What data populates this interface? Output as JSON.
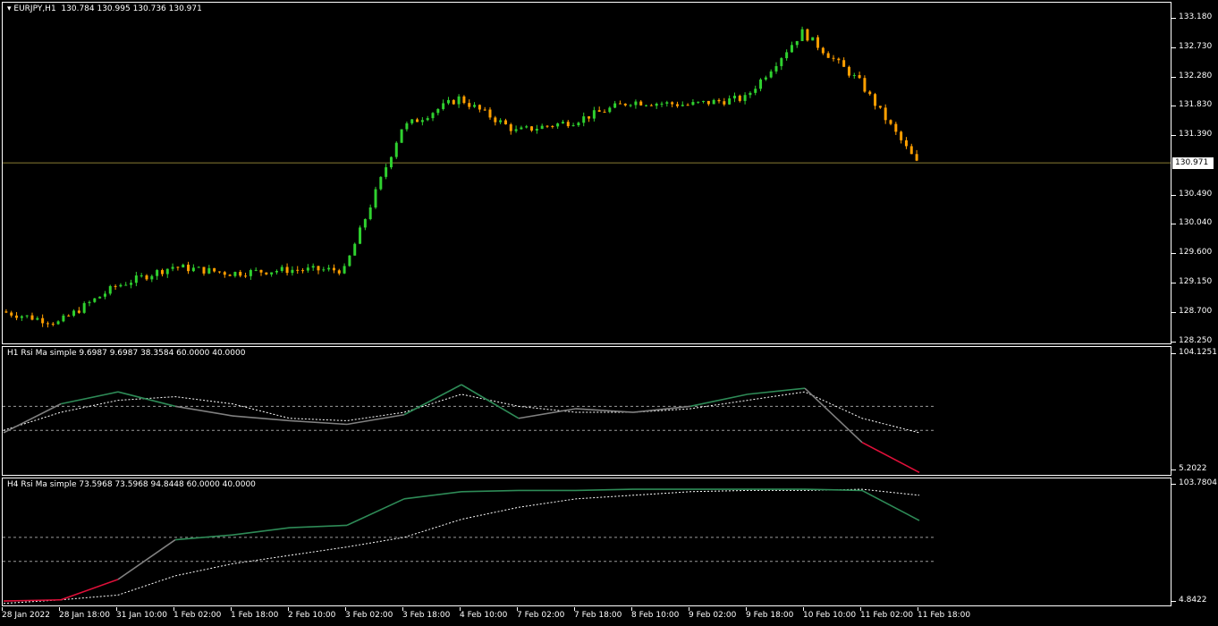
{
  "main": {
    "symbol_label": "EURJPY,H1",
    "ohlc": "130.784 130.995 130.736 130.971",
    "current_price": "130.971",
    "price_ticks": [
      "133.180",
      "132.730",
      "132.280",
      "131.830",
      "131.390",
      "130.971",
      "130.490",
      "130.040",
      "129.600",
      "129.150",
      "128.700",
      "128.250"
    ]
  },
  "indicator1": {
    "label": "H1 Rsi Ma simple 9.6987 9.6987 38.3584 60.0000 40.0000",
    "ticks": [
      "104.1251",
      "5.2022"
    ]
  },
  "indicator2": {
    "label": "H4 Rsi Ma simple 73.5968 73.5968 94.8448 60.0000 40.0000",
    "ticks": [
      "103.7804",
      "4.8422"
    ]
  },
  "time_labels": [
    "28 Jan 2022",
    "28 Jan 18:00",
    "31 Jan 10:00",
    "1 Feb 02:00",
    "1 Feb 18:00",
    "2 Feb 10:00",
    "3 Feb 02:00",
    "3 Feb 18:00",
    "4 Feb 10:00",
    "7 Feb 02:00",
    "7 Feb 18:00",
    "8 Feb 10:00",
    "9 Feb 02:00",
    "9 Feb 18:00",
    "10 Feb 10:00",
    "11 Feb 02:00",
    "11 Feb 18:00"
  ],
  "colors": {
    "up": "#2fd12f",
    "down": "#ff9f00",
    "rsi_up": "#2e8b57",
    "rsi_mid": "#808080",
    "rsi_down": "#e0103a",
    "ma": "#ffffff",
    "price_line": "#8a7d33"
  },
  "chart_data": [
    {
      "type": "candlestick",
      "title": "EURJPY,H1",
      "ylim": [
        128.25,
        133.18
      ],
      "x": [
        "28 Jan 2022",
        "28 Jan 18:00",
        "31 Jan 10:00",
        "1 Feb 02:00",
        "1 Feb 18:00",
        "2 Feb 10:00",
        "3 Feb 02:00",
        "3 Feb 18:00",
        "4 Feb 10:00",
        "7 Feb 02:00",
        "7 Feb 18:00",
        "8 Feb 10:00",
        "9 Feb 02:00",
        "9 Feb 18:00",
        "10 Feb 10:00",
        "11 Feb 02:00",
        "11 Feb 18:00"
      ],
      "close": [
        128.72,
        128.55,
        129.1,
        129.4,
        129.3,
        129.35,
        129.35,
        131.5,
        131.95,
        131.45,
        131.6,
        131.9,
        131.85,
        131.95,
        132.95,
        132.2,
        130.97
      ]
    },
    {
      "type": "line",
      "title": "H1 Rsi Ma simple",
      "ylim": [
        5.2022,
        104.1251
      ],
      "levels": [
        60,
        40
      ],
      "series": [
        {
          "name": "RSI",
          "values": [
            38,
            62,
            72,
            60,
            52,
            48,
            45,
            53,
            78,
            50,
            58,
            55,
            60,
            70,
            75,
            30,
            5
          ]
        },
        {
          "name": "MA",
          "values": [
            40,
            55,
            65,
            68,
            62,
            50,
            48,
            55,
            70,
            60,
            55,
            55,
            58,
            65,
            72,
            50,
            38
          ]
        }
      ]
    },
    {
      "type": "line",
      "title": "H4 Rsi Ma simple",
      "ylim": [
        4.8422,
        103.7804
      ],
      "levels": [
        60,
        40
      ],
      "series": [
        {
          "name": "RSI",
          "values": [
            7,
            8,
            25,
            58,
            62,
            68,
            70,
            92,
            98,
            99,
            99,
            100,
            100,
            100,
            100,
            99,
            74
          ]
        },
        {
          "name": "MA",
          "values": [
            5,
            8,
            12,
            28,
            38,
            45,
            52,
            60,
            75,
            85,
            92,
            95,
            98,
            99,
            99,
            100,
            95
          ]
        }
      ]
    }
  ]
}
